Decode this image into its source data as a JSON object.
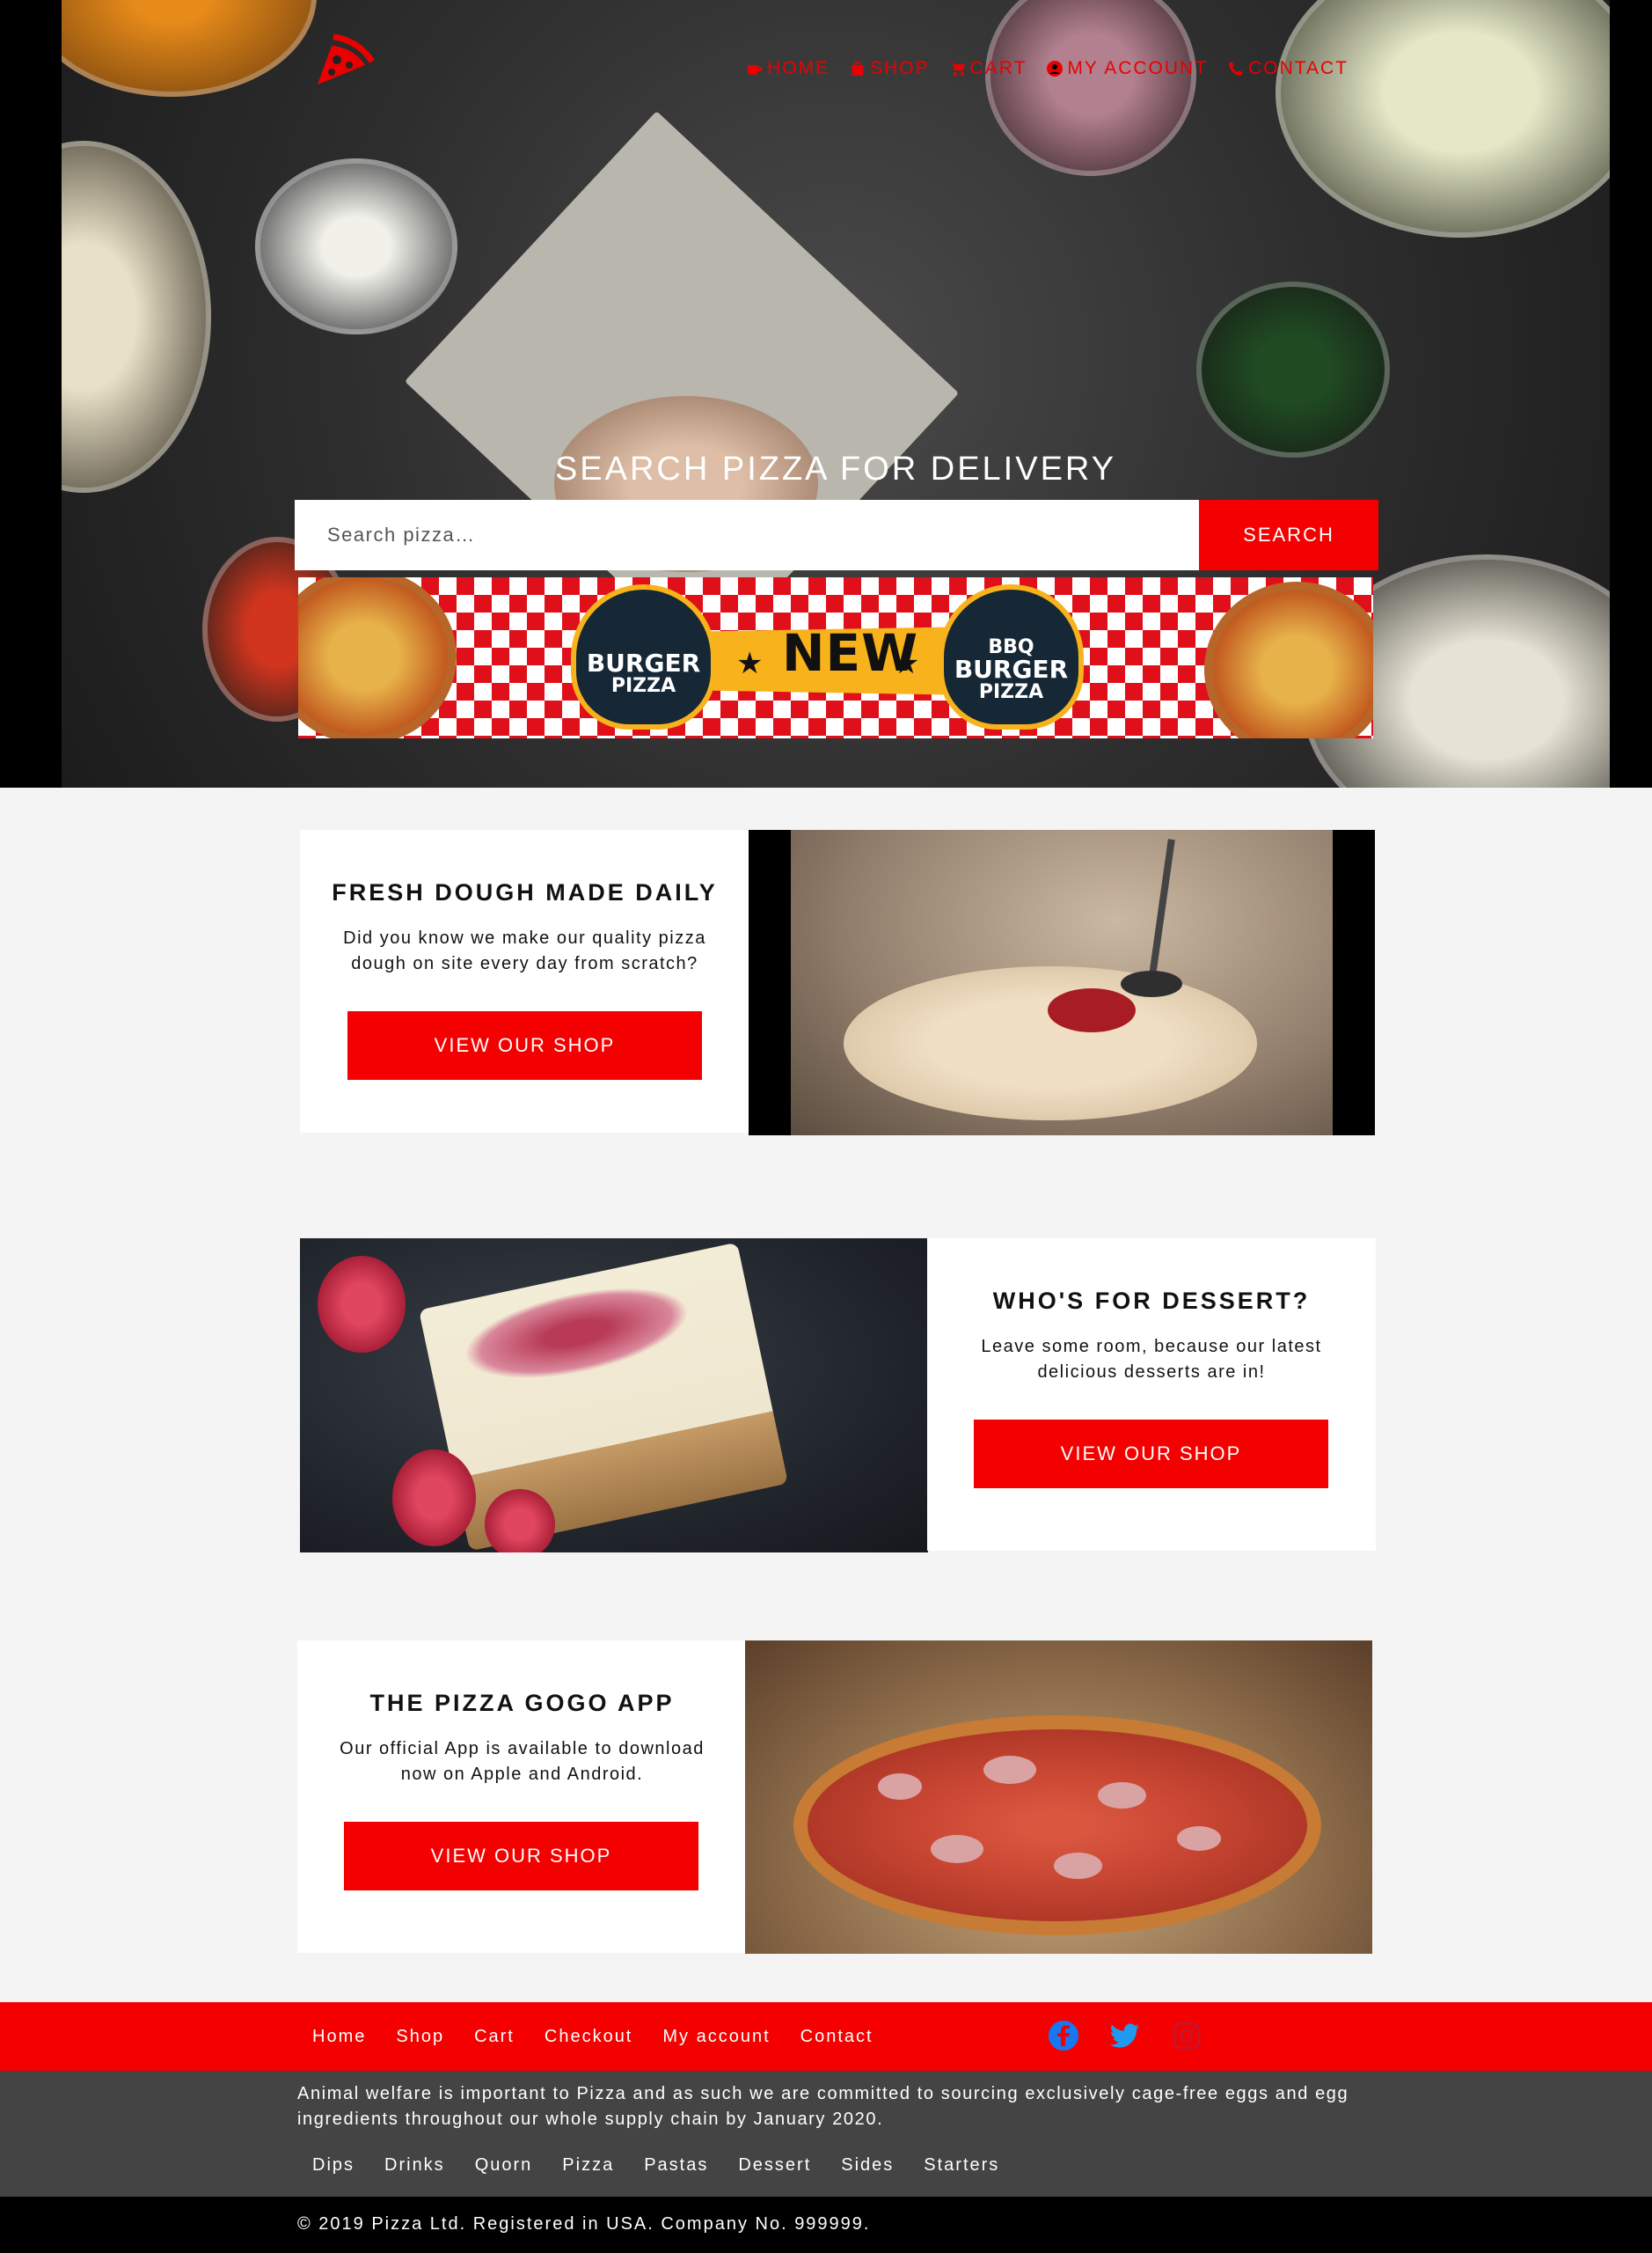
{
  "nav": {
    "items": [
      {
        "label": "HOME",
        "icon": "coffee-cup-icon"
      },
      {
        "label": "SHOP",
        "icon": "shopping-bag-icon"
      },
      {
        "label": "CART",
        "icon": "shopping-cart-icon"
      },
      {
        "label": "MY ACCOUNT",
        "icon": "user-circle-icon"
      },
      {
        "label": "CONTACT",
        "icon": "phone-icon"
      }
    ]
  },
  "hero": {
    "title": "SEARCH PIZZA FOR DELIVERY",
    "search_placeholder": "Search pizza…",
    "search_button": "SEARCH"
  },
  "banner": {
    "badge_left_line1": "BURGER",
    "badge_left_line2": "PIZZA",
    "new_label": "NEW",
    "badge_right_line0": "BBQ",
    "badge_right_line1": "BURGER",
    "badge_right_line2": "PIZZA"
  },
  "promos": [
    {
      "title": "FRESH DOUGH MADE DAILY",
      "description": "Did you know we make our quality pizza dough on site every day from scratch?",
      "button": "VIEW OUR SHOP"
    },
    {
      "title": "WHO'S FOR DESSERT?",
      "description": "Leave some room, because our latest delicious desserts are in!",
      "button": "VIEW OUR SHOP"
    },
    {
      "title": "THE PIZZA GOGO APP",
      "description": "Our official App is available to download now on Apple and Android.",
      "button": "VIEW OUR SHOP"
    }
  ],
  "footer": {
    "links": [
      "Home",
      "Shop",
      "Cart",
      "Checkout",
      "My account",
      "Contact"
    ],
    "social": [
      "facebook-icon",
      "twitter-icon",
      "instagram-icon"
    ],
    "welfare": "Animal welfare is important to Pizza and as such we are committed to sourcing exclusively cage-free eggs and egg ingredients throughout our whole supply chain by January 2020.",
    "categories": [
      "Dips",
      "Drinks",
      "Quorn",
      "Pizza",
      "Pastas",
      "Dessert",
      "Sides",
      "Starters"
    ],
    "copyright": "© 2019 Pizza Ltd. Registered in USA. Company No. 999999."
  },
  "colors": {
    "brand_red": "#f40000",
    "footer_gray": "#444444",
    "page_bg": "#f4f4f4"
  }
}
